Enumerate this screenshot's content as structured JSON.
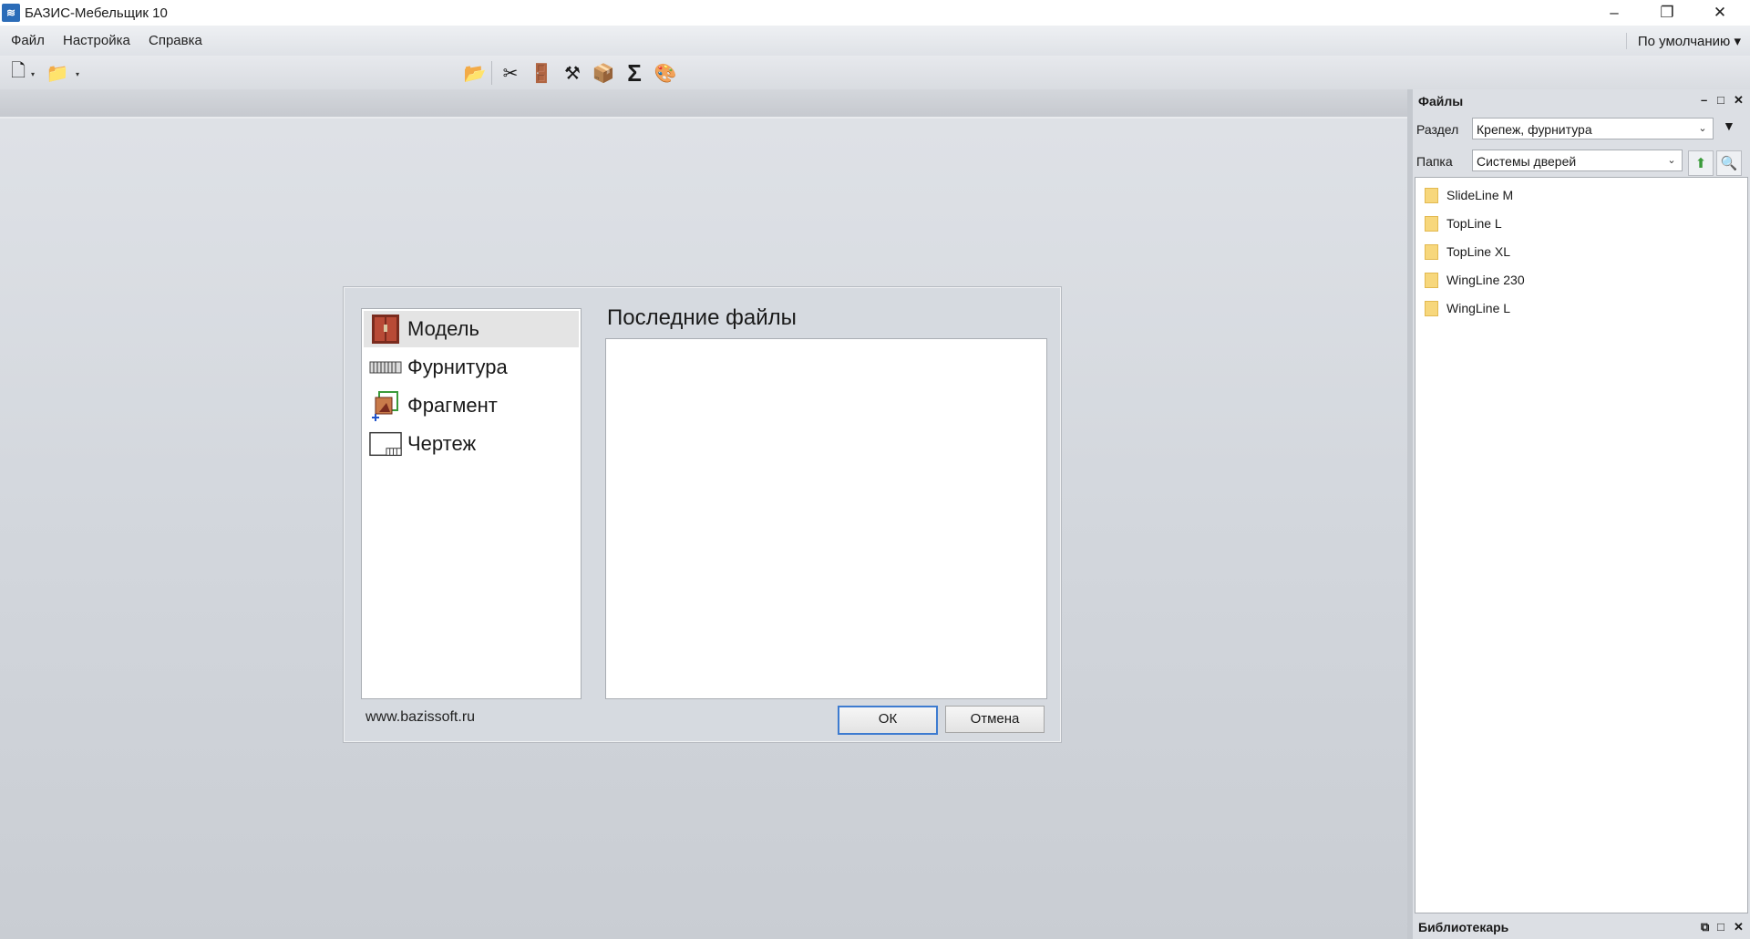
{
  "window": {
    "title": "БАЗИС-Мебельщик 10",
    "app_icon_glyph": "≋",
    "controls": {
      "minimize": "–",
      "restore": "❐",
      "close": "✕"
    }
  },
  "menu": {
    "items": [
      "Файл",
      "Настройка",
      "Справка"
    ],
    "profile": "По умолчанию ▾"
  },
  "toolbar": {
    "new_glyph": "🗋",
    "open_glyph": "📁",
    "arrow_glyph": "▾",
    "tools": [
      {
        "name": "open-project-icon",
        "glyph": "📂"
      },
      {
        "name": "cutting-icon",
        "glyph": "✂"
      },
      {
        "name": "cabinet-icon",
        "glyph": "🚪"
      },
      {
        "name": "stamp-icon",
        "glyph": "⚒"
      },
      {
        "name": "box-icon",
        "glyph": "📦"
      },
      {
        "name": "sum-icon",
        "glyph": "Σ"
      },
      {
        "name": "render-icon",
        "glyph": "🎨"
      }
    ]
  },
  "dialog": {
    "items": [
      "Модель",
      "Фурнитура",
      "Фрагмент",
      "Чертеж"
    ],
    "recent_title": "Последние файлы",
    "url": "www.bazissoft.ru",
    "ok_label": "ОК",
    "cancel_label": "Отмена"
  },
  "files_panel": {
    "title": "Файлы",
    "controls": {
      "minimize": "–",
      "maximize": "□",
      "close": "✕"
    },
    "section_label": "Раздел",
    "section_value": "Крепеж, фурнитура",
    "folder_label": "Папка",
    "folder_value": "Системы дверей",
    "filter_glyph": "▼",
    "up_glyph": "⬆",
    "search_glyph": "🔍",
    "dropdown_glyph": "⌄",
    "folders": [
      "SlideLine M",
      "TopLine L",
      "TopLine XL",
      "WingLine 230",
      "WingLine L"
    ]
  },
  "librarian_panel": {
    "title": "Библиотекарь",
    "controls": {
      "float": "⧉",
      "maximize": "□",
      "close": "✕"
    }
  }
}
